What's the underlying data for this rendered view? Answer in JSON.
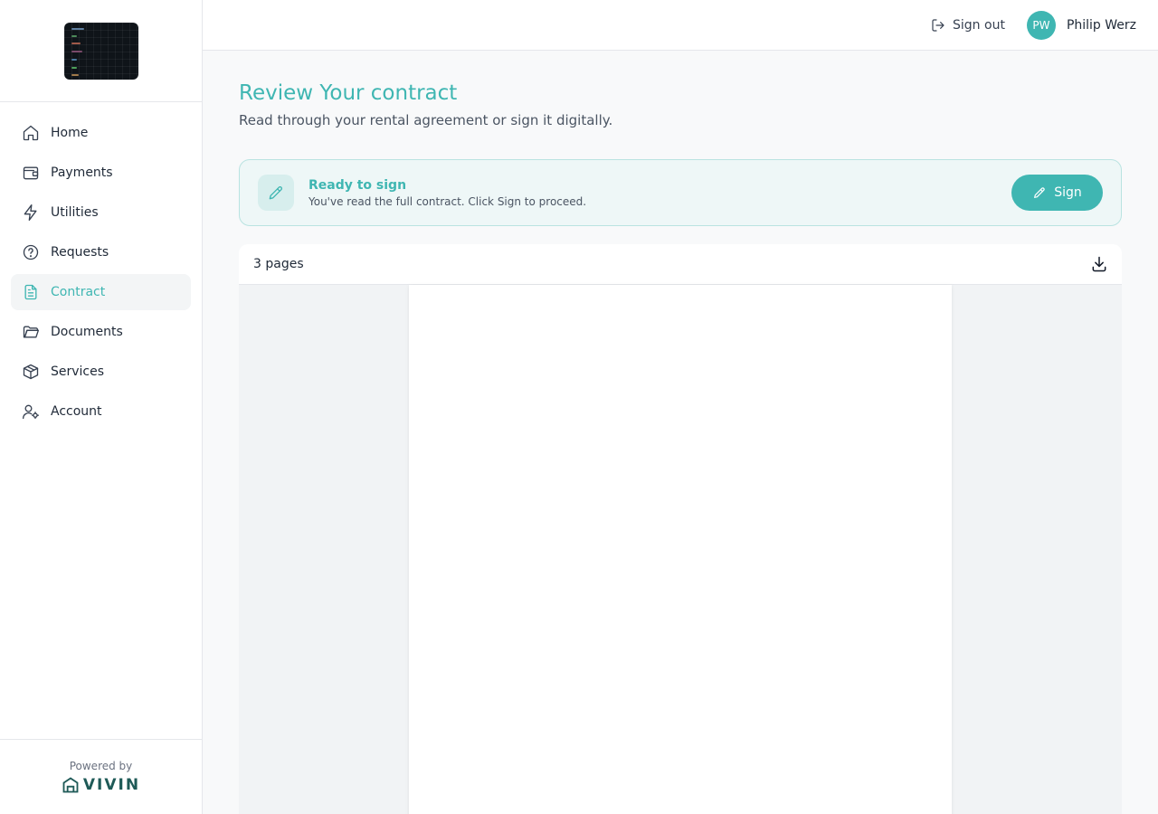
{
  "sidebar": {
    "items": [
      {
        "label": "Home",
        "icon": "home-icon"
      },
      {
        "label": "Payments",
        "icon": "wallet-icon"
      },
      {
        "label": "Utilities",
        "icon": "lightning-icon"
      },
      {
        "label": "Requests",
        "icon": "question-icon"
      },
      {
        "label": "Contract",
        "icon": "document-icon",
        "active": true
      },
      {
        "label": "Documents",
        "icon": "folder-icon"
      },
      {
        "label": "Services",
        "icon": "package-icon"
      },
      {
        "label": "Account",
        "icon": "user-settings-icon"
      }
    ],
    "footer": {
      "powered_by": "Powered by",
      "brand": "VIVIN"
    }
  },
  "topbar": {
    "signout_label": "Sign out",
    "user_initials": "PW",
    "user_name": "Philip Werz"
  },
  "main": {
    "title": "Review Your contract",
    "subtitle": "Read through your rental agreement or sign it digitally.",
    "banner": {
      "title": "Ready to sign",
      "description": "You've read the full contract. Click Sign to proceed.",
      "button_label": "Sign"
    },
    "viewer": {
      "page_count_label": "3 pages"
    }
  },
  "colors": {
    "accent": "#3fb6b2",
    "brand": "#1e5a57"
  }
}
